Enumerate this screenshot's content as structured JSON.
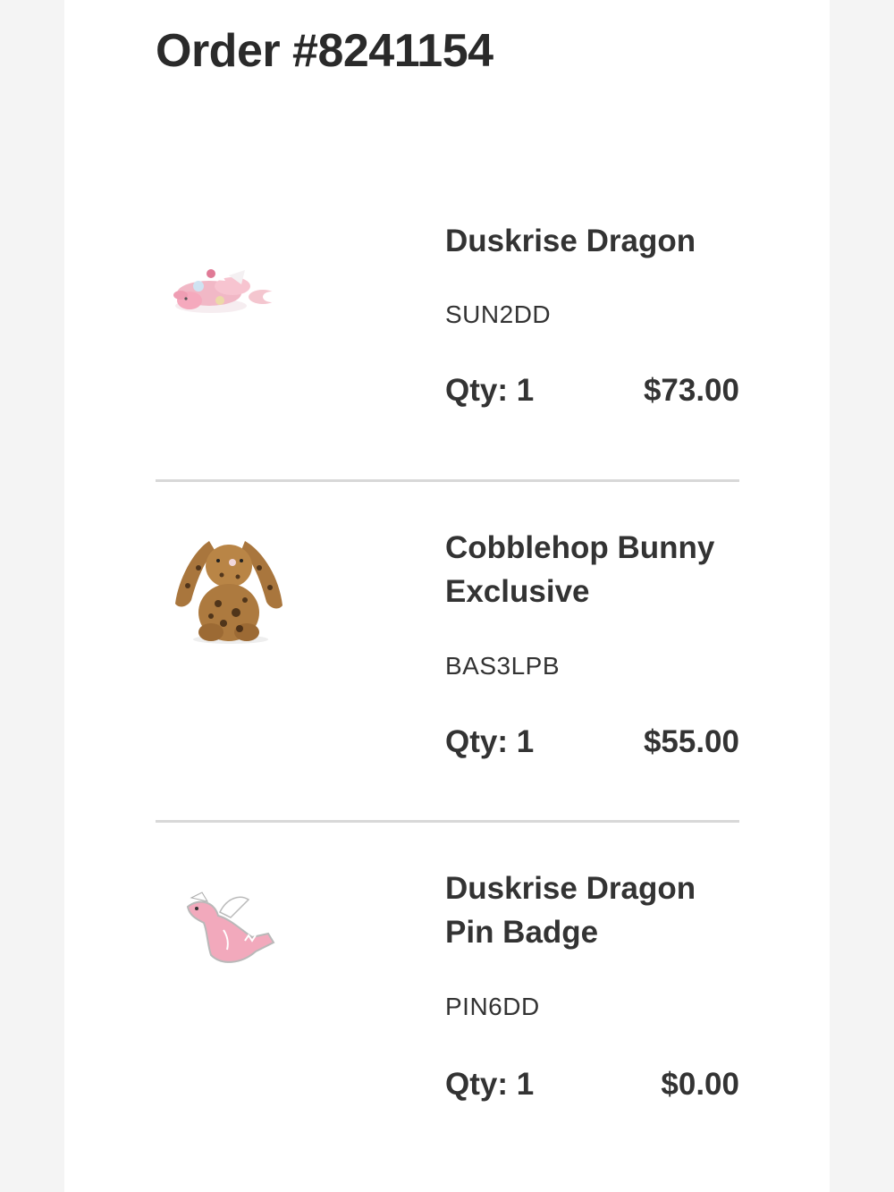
{
  "order": {
    "title": "Order #8241154"
  },
  "items": [
    {
      "name": "Duskrise Dragon",
      "sku": "SUN2DD",
      "qty_label": "Qty: 1",
      "price": "$73.00",
      "image": "pink-dragon-plush-icon"
    },
    {
      "name": "Cobblehop Bunny Exclusive",
      "sku": "BAS3LPB",
      "qty_label": "Qty: 1",
      "price": "$55.00",
      "image": "leopard-bunny-plush-icon"
    },
    {
      "name": "Duskrise Dragon Pin Badge",
      "sku": "PIN6DD",
      "qty_label": "Qty: 1",
      "price": "$0.00",
      "image": "dragon-pin-badge-icon"
    }
  ],
  "colors": {
    "page_bg": "#f4f4f4",
    "card_bg": "#ffffff",
    "text": "#2b2b2b",
    "divider": "#d8d8d8"
  }
}
